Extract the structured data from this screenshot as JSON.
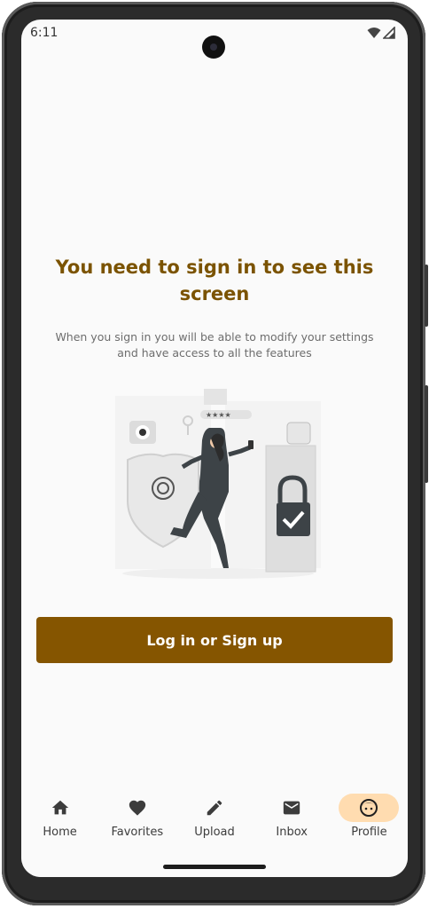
{
  "status_bar": {
    "time": "6:11"
  },
  "signin": {
    "title_line1": "You need to sign in to see this",
    "title_line2": "screen",
    "subtitle_line1": "When you sign in you will be able to modify your settings",
    "subtitle_line2": "and have access to all the features",
    "illustration_icon": "security-lock-illustration",
    "button_label": "Log in or Sign up"
  },
  "nav": {
    "items": [
      {
        "label": "Home",
        "icon": "home-icon"
      },
      {
        "label": "Favorites",
        "icon": "heart-icon"
      },
      {
        "label": "Upload",
        "icon": "pencil-icon"
      },
      {
        "label": "Inbox",
        "icon": "mail-icon"
      },
      {
        "label": "Profile",
        "icon": "face-icon",
        "active": true
      }
    ]
  },
  "colors": {
    "accent": "#855500",
    "title": "#7b5300",
    "active_pill": "#ffdcb0",
    "background": "#fafafa"
  }
}
